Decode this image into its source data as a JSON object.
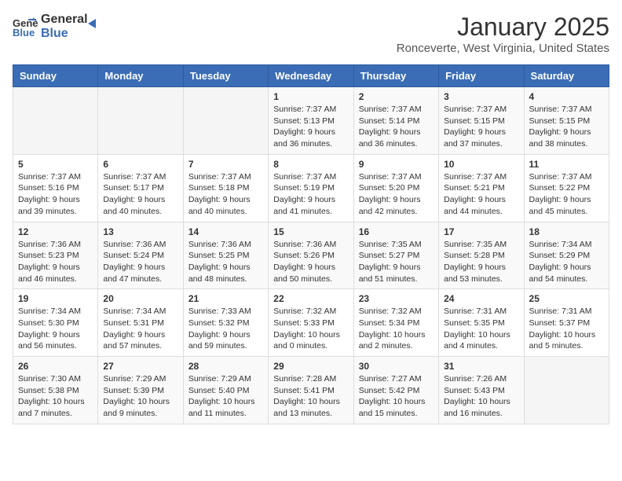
{
  "logo": {
    "general": "General",
    "blue": "Blue"
  },
  "title": "January 2025",
  "location": "Ronceverte, West Virginia, United States",
  "weekdays": [
    "Sunday",
    "Monday",
    "Tuesday",
    "Wednesday",
    "Thursday",
    "Friday",
    "Saturday"
  ],
  "weeks": [
    [
      {
        "day": "",
        "info": ""
      },
      {
        "day": "",
        "info": ""
      },
      {
        "day": "",
        "info": ""
      },
      {
        "day": "1",
        "info": "Sunrise: 7:37 AM\nSunset: 5:13 PM\nDaylight: 9 hours\nand 36 minutes."
      },
      {
        "day": "2",
        "info": "Sunrise: 7:37 AM\nSunset: 5:14 PM\nDaylight: 9 hours\nand 36 minutes."
      },
      {
        "day": "3",
        "info": "Sunrise: 7:37 AM\nSunset: 5:15 PM\nDaylight: 9 hours\nand 37 minutes."
      },
      {
        "day": "4",
        "info": "Sunrise: 7:37 AM\nSunset: 5:15 PM\nDaylight: 9 hours\nand 38 minutes."
      }
    ],
    [
      {
        "day": "5",
        "info": "Sunrise: 7:37 AM\nSunset: 5:16 PM\nDaylight: 9 hours\nand 39 minutes."
      },
      {
        "day": "6",
        "info": "Sunrise: 7:37 AM\nSunset: 5:17 PM\nDaylight: 9 hours\nand 40 minutes."
      },
      {
        "day": "7",
        "info": "Sunrise: 7:37 AM\nSunset: 5:18 PM\nDaylight: 9 hours\nand 40 minutes."
      },
      {
        "day": "8",
        "info": "Sunrise: 7:37 AM\nSunset: 5:19 PM\nDaylight: 9 hours\nand 41 minutes."
      },
      {
        "day": "9",
        "info": "Sunrise: 7:37 AM\nSunset: 5:20 PM\nDaylight: 9 hours\nand 42 minutes."
      },
      {
        "day": "10",
        "info": "Sunrise: 7:37 AM\nSunset: 5:21 PM\nDaylight: 9 hours\nand 44 minutes."
      },
      {
        "day": "11",
        "info": "Sunrise: 7:37 AM\nSunset: 5:22 PM\nDaylight: 9 hours\nand 45 minutes."
      }
    ],
    [
      {
        "day": "12",
        "info": "Sunrise: 7:36 AM\nSunset: 5:23 PM\nDaylight: 9 hours\nand 46 minutes."
      },
      {
        "day": "13",
        "info": "Sunrise: 7:36 AM\nSunset: 5:24 PM\nDaylight: 9 hours\nand 47 minutes."
      },
      {
        "day": "14",
        "info": "Sunrise: 7:36 AM\nSunset: 5:25 PM\nDaylight: 9 hours\nand 48 minutes."
      },
      {
        "day": "15",
        "info": "Sunrise: 7:36 AM\nSunset: 5:26 PM\nDaylight: 9 hours\nand 50 minutes."
      },
      {
        "day": "16",
        "info": "Sunrise: 7:35 AM\nSunset: 5:27 PM\nDaylight: 9 hours\nand 51 minutes."
      },
      {
        "day": "17",
        "info": "Sunrise: 7:35 AM\nSunset: 5:28 PM\nDaylight: 9 hours\nand 53 minutes."
      },
      {
        "day": "18",
        "info": "Sunrise: 7:34 AM\nSunset: 5:29 PM\nDaylight: 9 hours\nand 54 minutes."
      }
    ],
    [
      {
        "day": "19",
        "info": "Sunrise: 7:34 AM\nSunset: 5:30 PM\nDaylight: 9 hours\nand 56 minutes."
      },
      {
        "day": "20",
        "info": "Sunrise: 7:34 AM\nSunset: 5:31 PM\nDaylight: 9 hours\nand 57 minutes."
      },
      {
        "day": "21",
        "info": "Sunrise: 7:33 AM\nSunset: 5:32 PM\nDaylight: 9 hours\nand 59 minutes."
      },
      {
        "day": "22",
        "info": "Sunrise: 7:32 AM\nSunset: 5:33 PM\nDaylight: 10 hours\nand 0 minutes."
      },
      {
        "day": "23",
        "info": "Sunrise: 7:32 AM\nSunset: 5:34 PM\nDaylight: 10 hours\nand 2 minutes."
      },
      {
        "day": "24",
        "info": "Sunrise: 7:31 AM\nSunset: 5:35 PM\nDaylight: 10 hours\nand 4 minutes."
      },
      {
        "day": "25",
        "info": "Sunrise: 7:31 AM\nSunset: 5:37 PM\nDaylight: 10 hours\nand 5 minutes."
      }
    ],
    [
      {
        "day": "26",
        "info": "Sunrise: 7:30 AM\nSunset: 5:38 PM\nDaylight: 10 hours\nand 7 minutes."
      },
      {
        "day": "27",
        "info": "Sunrise: 7:29 AM\nSunset: 5:39 PM\nDaylight: 10 hours\nand 9 minutes."
      },
      {
        "day": "28",
        "info": "Sunrise: 7:29 AM\nSunset: 5:40 PM\nDaylight: 10 hours\nand 11 minutes."
      },
      {
        "day": "29",
        "info": "Sunrise: 7:28 AM\nSunset: 5:41 PM\nDaylight: 10 hours\nand 13 minutes."
      },
      {
        "day": "30",
        "info": "Sunrise: 7:27 AM\nSunset: 5:42 PM\nDaylight: 10 hours\nand 15 minutes."
      },
      {
        "day": "31",
        "info": "Sunrise: 7:26 AM\nSunset: 5:43 PM\nDaylight: 10 hours\nand 16 minutes."
      },
      {
        "day": "",
        "info": ""
      }
    ]
  ]
}
